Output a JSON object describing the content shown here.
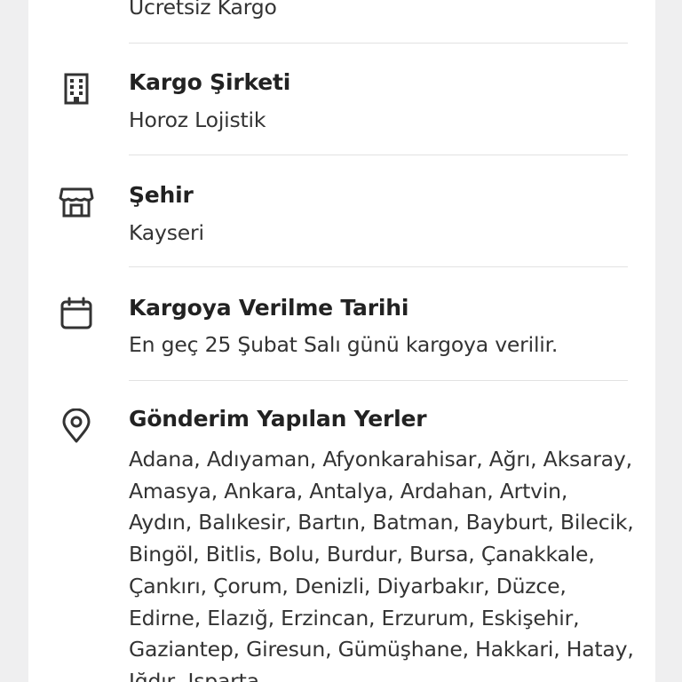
{
  "shipping": {
    "top_value": "Ücretsiz Kargo",
    "company": {
      "title": "Kargo Şirketi",
      "value": "Horoz Lojistik",
      "icon": "building-icon"
    },
    "city": {
      "title": "Şehir",
      "value": "Kayseri",
      "icon": "store-icon"
    },
    "dispatch_date": {
      "title": "Kargoya Verilme Tarihi",
      "value": "En geç 25 Şubat Salı günü kargoya verilir.",
      "icon": "calendar-icon"
    },
    "destinations": {
      "title": "Gönderim Yapılan Yerler",
      "value": "Adana, Adıyaman, Afyonkarahisar, Ağrı, Aksaray, Amasya, Ankara, Antalya, Ardahan, Artvin, Aydın, Balıkesir, Bartın, Batman, Bayburt, Bilecik, Bingöl, Bitlis, Bolu, Burdur, Bursa, Çanakkale, Çankırı, Çorum, Denizli, Diyarbakır, Düzce, Edirne, Elazığ, Erzincan, Erzurum, Eskişehir, Gaziantep, Giresun, Gümüşhane, Hakkari, Hatay, Iğdır, Isparta",
      "icon": "location-pin-icon"
    }
  }
}
